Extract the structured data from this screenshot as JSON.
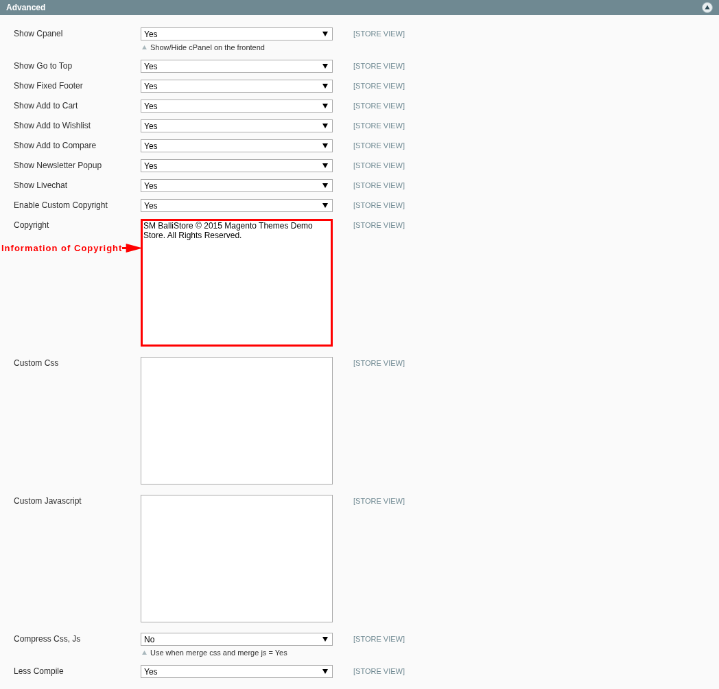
{
  "section": {
    "title": "Advanced",
    "expanded": true
  },
  "fields": [
    {
      "kind": "select",
      "label": "Show Cpanel",
      "value": "Yes",
      "hint": "Show/Hide cPanel on the frontend",
      "scope": "[STORE VIEW]"
    },
    {
      "kind": "select",
      "label": "Show Go to Top",
      "value": "Yes",
      "scope": "[STORE VIEW]"
    },
    {
      "kind": "select",
      "label": "Show Fixed Footer",
      "value": "Yes",
      "scope": "[STORE VIEW]"
    },
    {
      "kind": "select",
      "label": "Show Add to Cart",
      "value": "Yes",
      "scope": "[STORE VIEW]"
    },
    {
      "kind": "select",
      "label": "Show Add to Wishlist",
      "value": "Yes",
      "scope": "[STORE VIEW]"
    },
    {
      "kind": "select",
      "label": "Show Add to Compare",
      "value": "Yes",
      "scope": "[STORE VIEW]"
    },
    {
      "kind": "select",
      "label": "Show Newsletter Popup",
      "value": "Yes",
      "scope": "[STORE VIEW]"
    },
    {
      "kind": "select",
      "label": "Show Livechat",
      "value": "Yes",
      "scope": "[STORE VIEW]"
    },
    {
      "kind": "select",
      "label": "Enable Custom Copyright",
      "value": "Yes",
      "scope": "[STORE VIEW]"
    },
    {
      "kind": "textarea",
      "label": "Copyright",
      "value": "SM BalliStore © 2015 Magento Themes Demo Store. All Rights Reserved.",
      "highlighted": true,
      "annotation": "Information of Copyright",
      "scope": "[STORE VIEW]"
    },
    {
      "kind": "textarea",
      "label": "Custom Css",
      "highlighted": false,
      "scope": "[STORE VIEW]"
    },
    {
      "kind": "textarea",
      "label": "Custom Javascript",
      "highlighted": false,
      "scope": "[STORE VIEW]"
    },
    {
      "kind": "select",
      "label": "Compress Css, Js",
      "value": "No",
      "hint": "Use when merge css and merge js = Yes",
      "scope": "[STORE VIEW]"
    },
    {
      "kind": "select",
      "label": "Less Compile",
      "value": "Yes",
      "scope": "[STORE VIEW]"
    }
  ]
}
